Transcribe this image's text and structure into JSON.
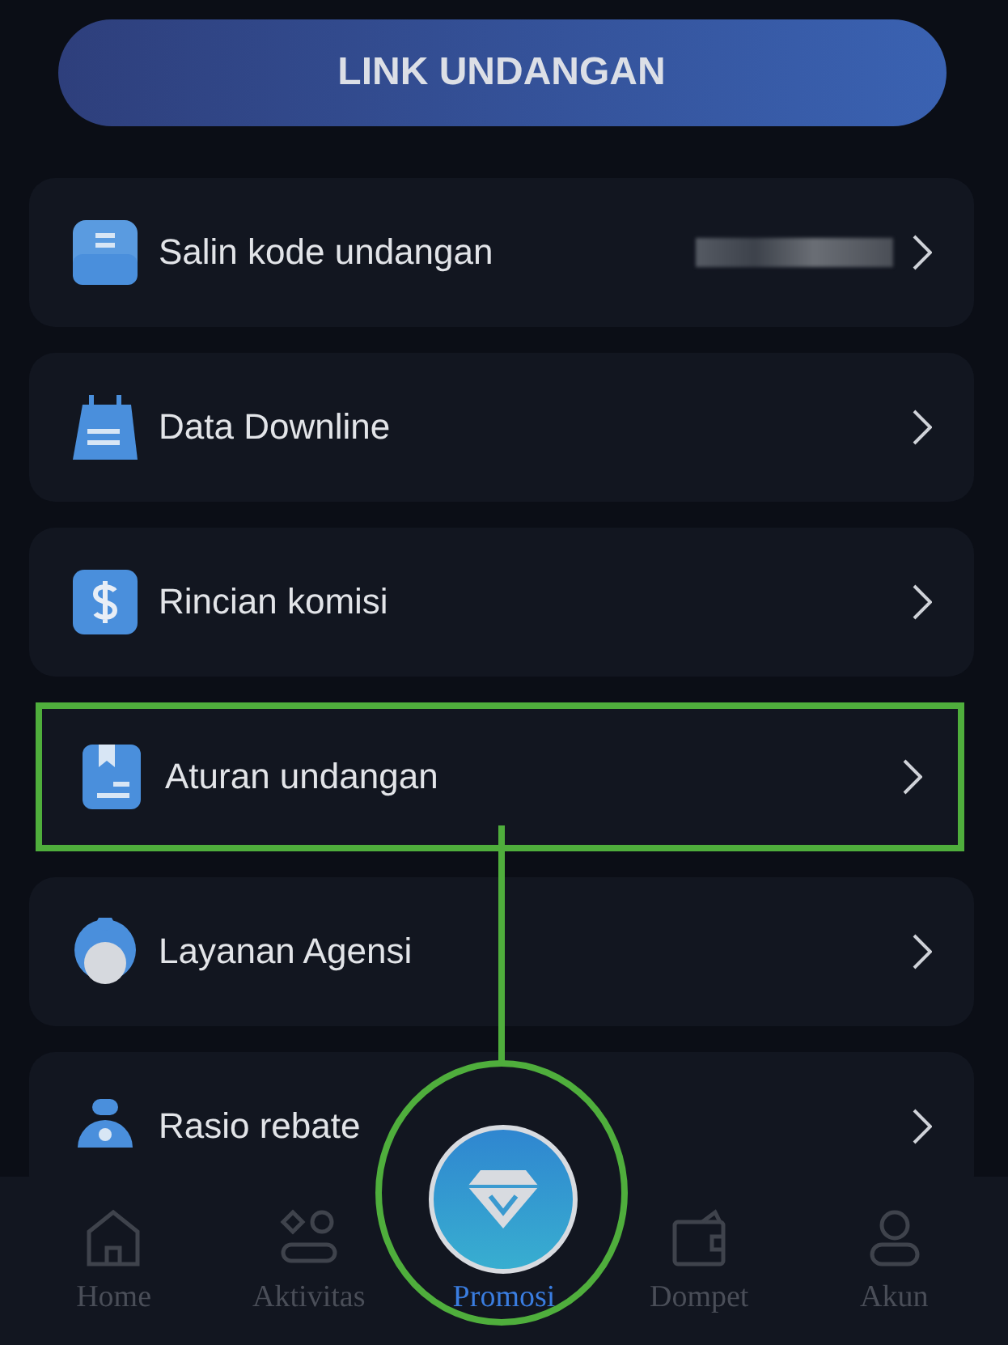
{
  "invite_button": {
    "label": "LINK UNDANGAN"
  },
  "menu": [
    {
      "label": "Salin kode undangan",
      "code_hidden": true,
      "highlighted": false
    },
    {
      "label": "Data Downline",
      "code_hidden": false,
      "highlighted": false
    },
    {
      "label": "Rincian komisi",
      "code_hidden": false,
      "highlighted": false
    },
    {
      "label": "Aturan undangan",
      "code_hidden": false,
      "highlighted": true
    },
    {
      "label": "Layanan Agensi",
      "code_hidden": false,
      "highlighted": false
    },
    {
      "label": "Rasio rebate",
      "code_hidden": false,
      "highlighted": false
    }
  ],
  "nav": [
    {
      "label": "Home",
      "selected": false
    },
    {
      "label": "Aktivitas",
      "selected": false
    },
    {
      "label": "Promosi",
      "selected": true
    },
    {
      "label": "Dompet",
      "selected": false
    },
    {
      "label": "Akun",
      "selected": false
    }
  ],
  "annotation": {
    "color": "#4fae3c"
  }
}
